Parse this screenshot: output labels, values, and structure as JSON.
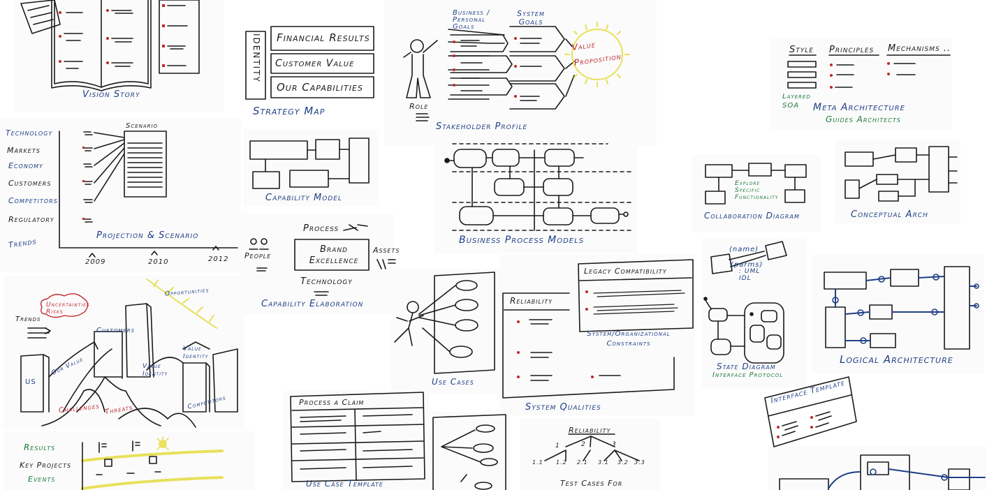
{
  "vision_story": {
    "title": "Vision Story"
  },
  "strategy_map": {
    "title": "Strategy Map",
    "identity": "IDENTITY",
    "rows": [
      "Financial Results",
      "Customer Value",
      "Our Capabilities"
    ]
  },
  "stakeholder_profile": {
    "title": "Stakeholder Profile",
    "col1": "Business / Personal Goals",
    "col2": "System Goals",
    "value_prop": "Value Proposition",
    "role": "Role"
  },
  "meta_architecture": {
    "headers": [
      "Style",
      "Principles",
      "Mechanisms .."
    ],
    "layered": "Layered SOA",
    "title": "Meta Architecture",
    "subtitle": "Guides Architects"
  },
  "projection": {
    "factors": [
      "Technology",
      "Markets",
      "Economy",
      "Customers",
      "Competitors",
      "Regulatory"
    ],
    "trends": "Trends",
    "scenario": "Scenario",
    "title": "Projection & Scenario",
    "years": [
      "2009",
      "2010",
      "2012"
    ]
  },
  "capability_model": {
    "title": "Capability Model"
  },
  "business_process": {
    "title": "Business Process Models"
  },
  "collaboration": {
    "title": "Collaboration Diagram",
    "note": "Explore Specific Functionality"
  },
  "conceptual": {
    "title": "Conceptual Arch"
  },
  "capability_elaboration": {
    "title": "Capability Elaboration",
    "process": "Process",
    "center": "Brand Excellence",
    "people": "People",
    "assets": "Assets",
    "technology": "Technology"
  },
  "landscape": {
    "opportunities": "Opportunities",
    "trends": "Trends",
    "uncertainties": "Uncertainties Risks",
    "customers": "Customers",
    "our_value": "Our Value",
    "value_identity_1": "Value Identity",
    "value_identity_2": "Value Identity",
    "us": "US",
    "challenges": "Challenges",
    "threats": "Threats",
    "competitors": "Competitors"
  },
  "use_cases": {
    "title": "Use Cases"
  },
  "system_qualities": {
    "title": "System Qualities",
    "reliability": "Reliability",
    "legacy": "Legacy Compatibility",
    "constraints": "System/Organizational Constraints"
  },
  "state_diagram": {
    "title": "State Diagram",
    "subtitle": "Interface Protocol",
    "name": "(name)",
    "parms": "(parms)",
    "uml": ": UML IDL"
  },
  "logical_arch": {
    "title": "Logical Architecture"
  },
  "interface_template": {
    "title": "Interface Template"
  },
  "results": {
    "items": [
      "Results",
      "Key Projects",
      "Events"
    ]
  },
  "use_case_template": {
    "title": "Use Case Template",
    "header": "Process a Claim"
  },
  "test_cases": {
    "title": "Test Cases For",
    "root": "Reliability",
    "level1": [
      "1",
      "2",
      "3"
    ],
    "level2": [
      "1.1",
      "1.2",
      "2.1",
      "3.1",
      "3.2",
      "3.3"
    ]
  }
}
